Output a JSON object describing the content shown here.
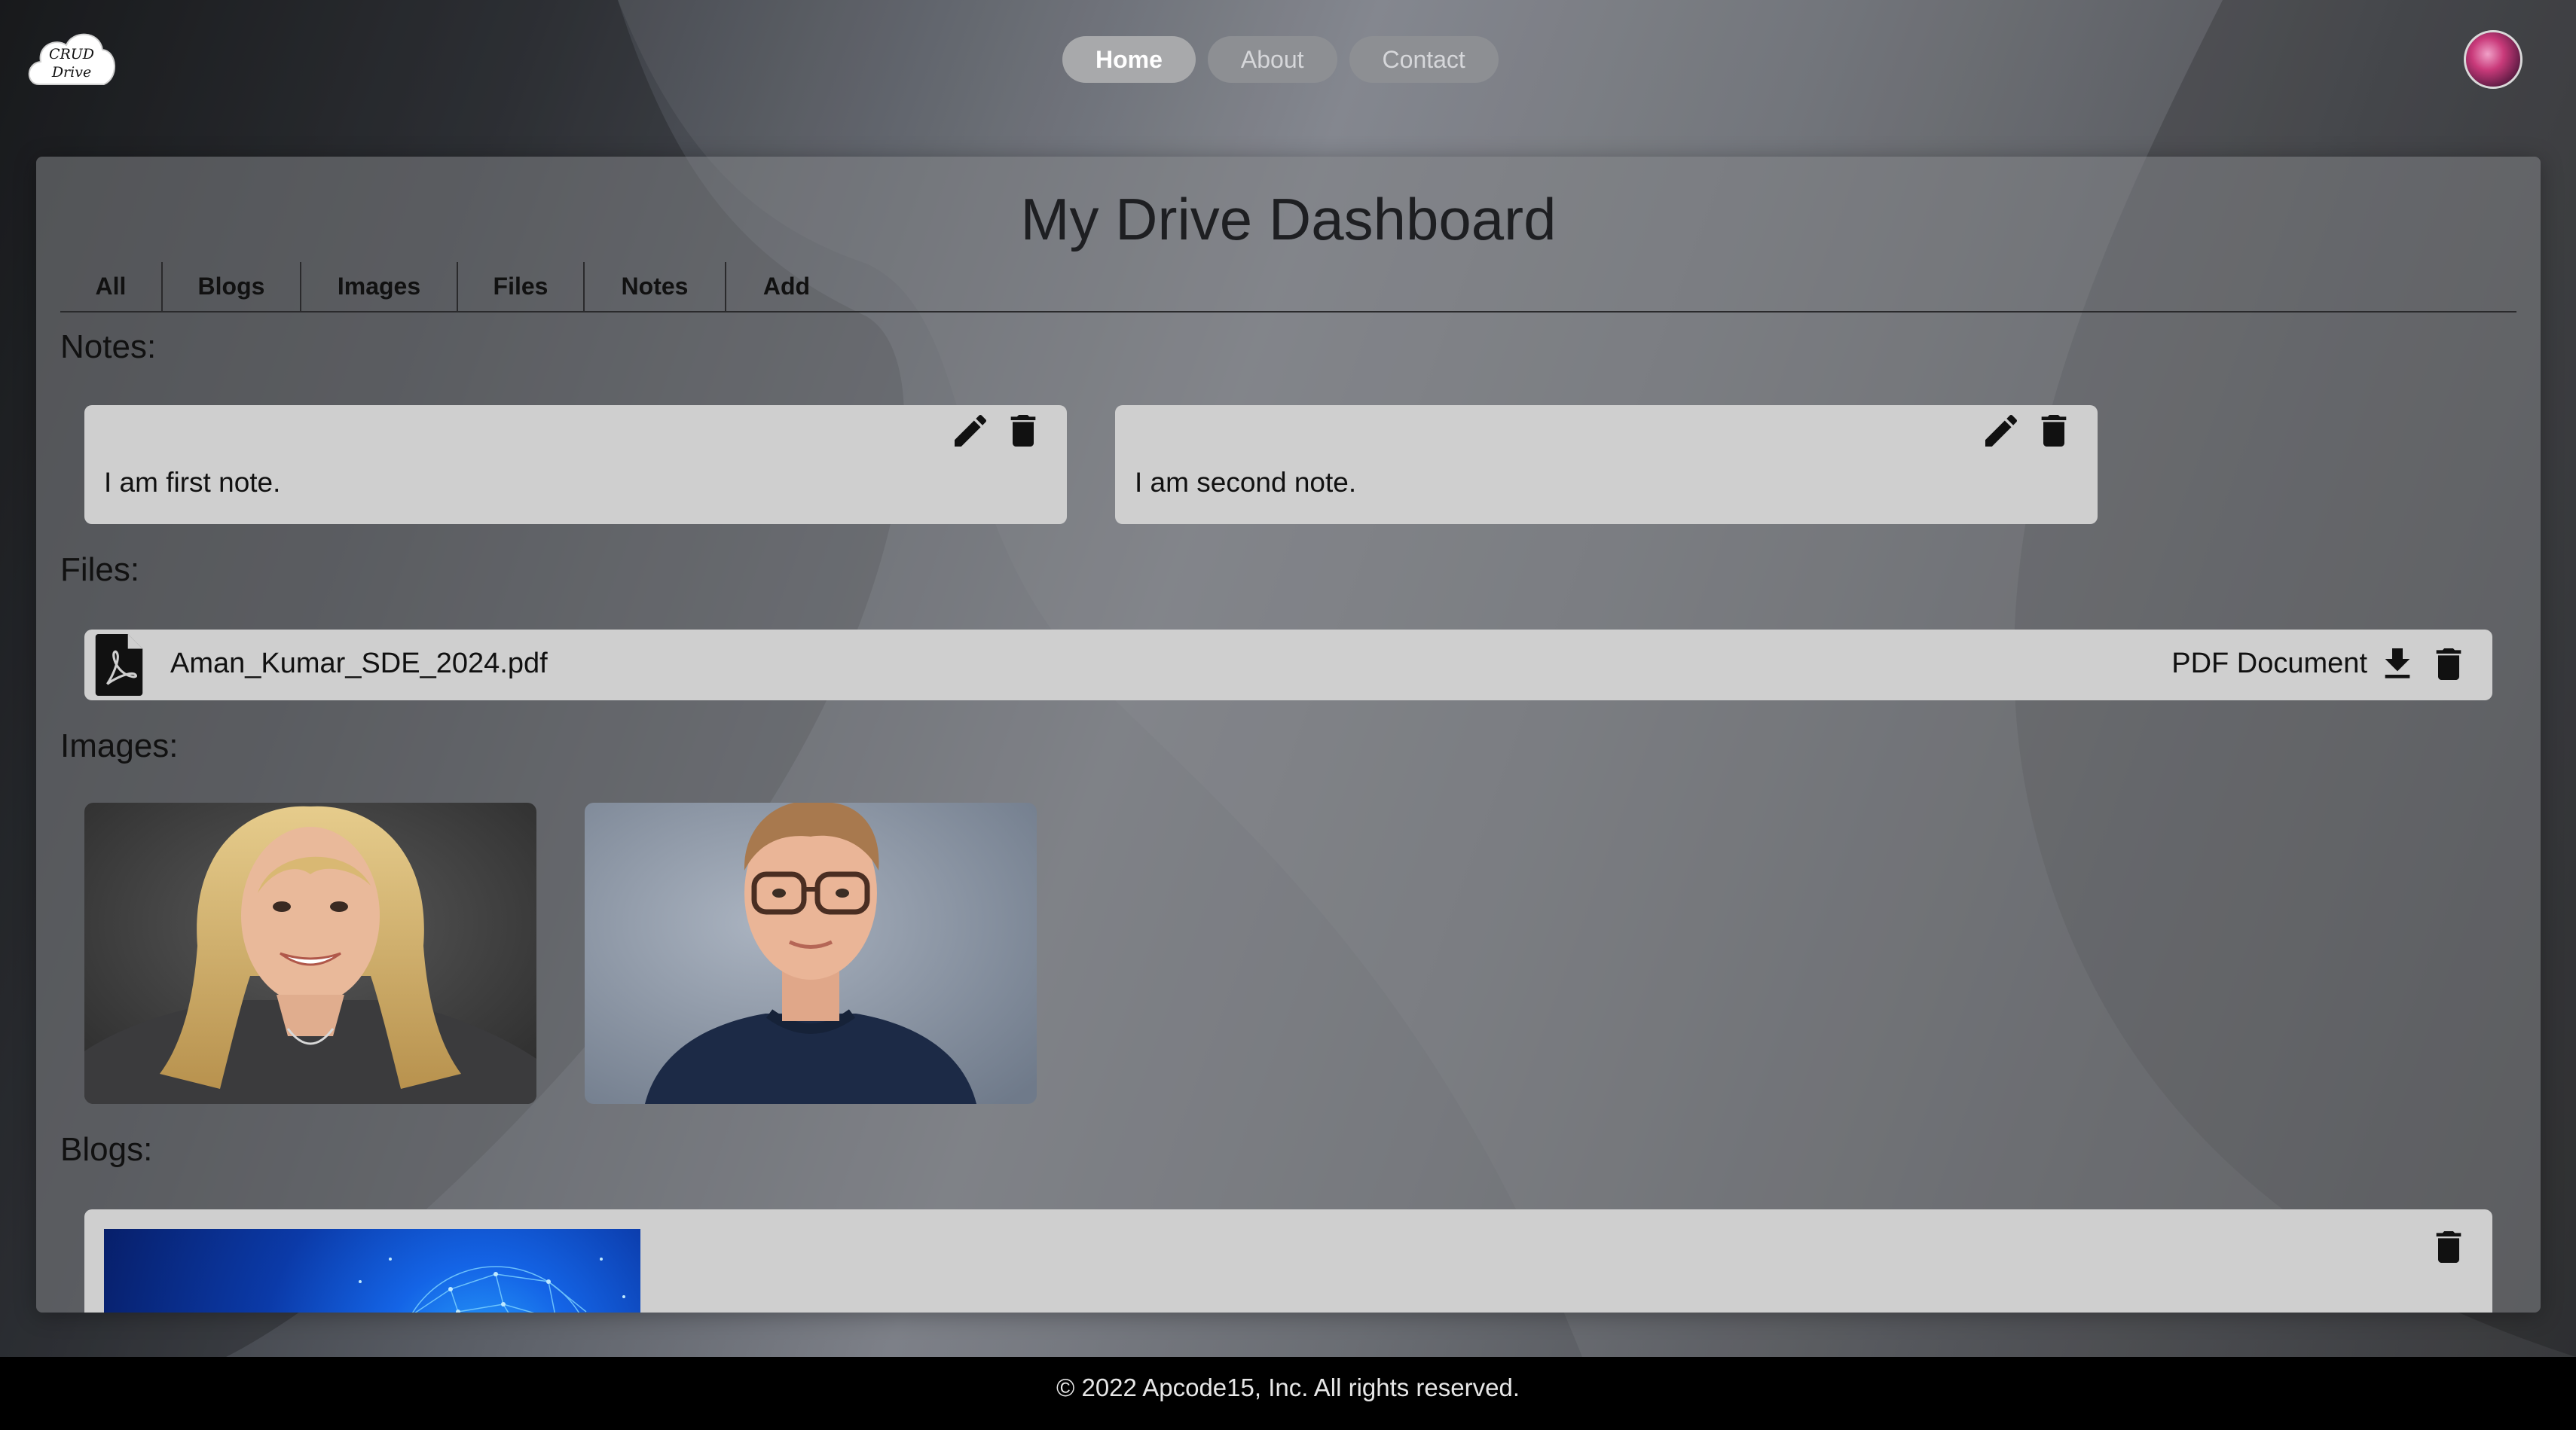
{
  "logo": {
    "line1": "CRUD",
    "line2": "Drive"
  },
  "nav": {
    "items": [
      {
        "label": "Home",
        "active": true
      },
      {
        "label": "About",
        "active": false
      },
      {
        "label": "Contact",
        "active": false
      }
    ]
  },
  "dashboard": {
    "title": "My Drive Dashboard",
    "tabs": [
      {
        "label": "All"
      },
      {
        "label": "Blogs"
      },
      {
        "label": "Images"
      },
      {
        "label": "Files"
      },
      {
        "label": "Notes"
      },
      {
        "label": "Add"
      }
    ]
  },
  "sections": {
    "notes": "Notes:",
    "files": "Files:",
    "images": "Images:",
    "blogs": "Blogs:"
  },
  "notes": [
    {
      "text": "I am first note.",
      "edit_icon": "pencil-icon",
      "delete_icon": "trash-icon"
    },
    {
      "text": "I am second note.",
      "edit_icon": "pencil-icon",
      "delete_icon": "trash-icon"
    }
  ],
  "files": [
    {
      "name": "Aman_Kumar_SDE_2024.pdf",
      "type": "PDF Document",
      "file_icon": "pdf-file-icon",
      "download_icon": "download-icon",
      "delete_icon": "trash-icon"
    }
  ],
  "images": [
    {
      "name": "portrait-woman-image"
    },
    {
      "name": "portrait-man-image"
    }
  ],
  "blogs": [
    {
      "delete_icon": "trash-icon"
    }
  ],
  "footer": {
    "text": "© 2022 Apcode15, Inc. All rights reserved."
  },
  "colors": {
    "card": "#cfcfcf",
    "footer": "#000000",
    "nav_active": "#a8a9ab",
    "nav_inactive": "#8d8f93"
  }
}
